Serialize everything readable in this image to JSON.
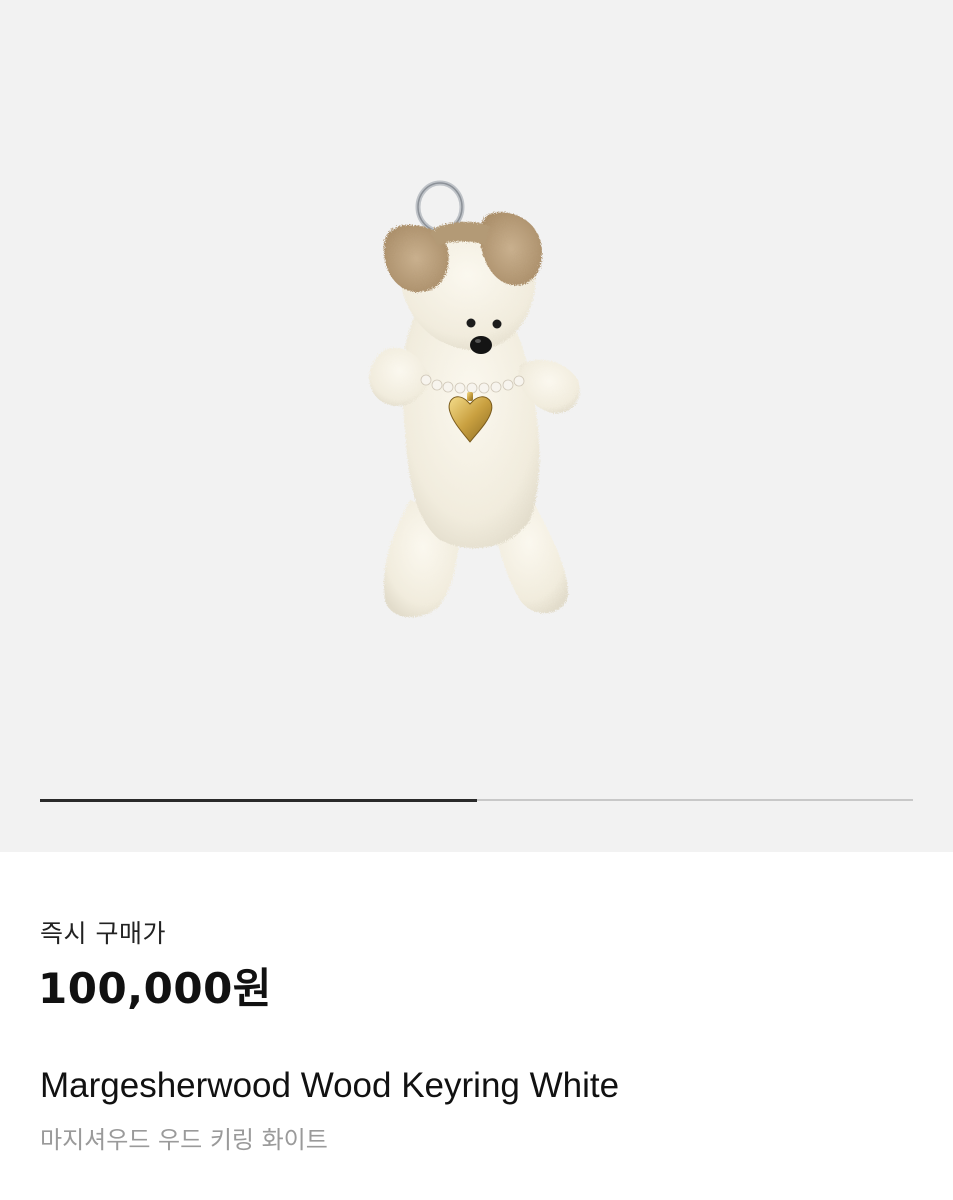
{
  "product": {
    "image_icon": "bear-keyring-image",
    "gallery_progress": 0.5,
    "price_label": "즉시 구매가",
    "price": "100,000원",
    "name_en": "Margesherwood Wood Keyring White",
    "name_ko": "마지셔우드 우드 키링 화이트"
  },
  "colors": {
    "gallery_bg": "#f2f2f2",
    "progress_fill": "#2a2a2a",
    "progress_track": "#c8c8c8",
    "subtitle": "#9a9a9a"
  }
}
